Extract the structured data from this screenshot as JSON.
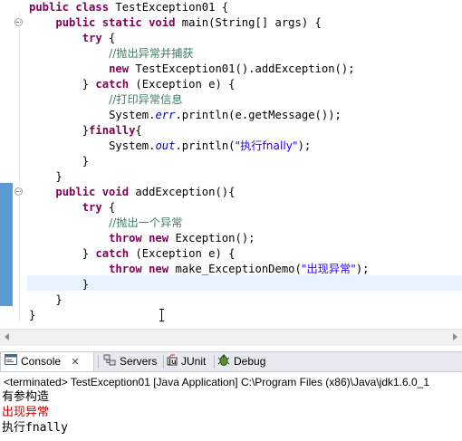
{
  "editor": {
    "lines": {
      "l1": {
        "kw": "public class",
        "rest": " TestException01 {"
      },
      "l2": {
        "kw": "public static void",
        "rest": " main(String[] args) {"
      },
      "l3": {
        "kw": "try",
        "rest": " {"
      },
      "l4": {
        "comment": "//抛出异常并捕获"
      },
      "l5": {
        "kw": "new",
        "rest": " TestException01().addException();"
      },
      "l6": {
        "pre": "} ",
        "kw": "catch",
        "rest": " (Exception e) {"
      },
      "l7": {
        "comment": "//打印异常信息"
      },
      "l8": {
        "pre": "System.",
        "field": "err",
        "rest": ".println(e.getMessage());"
      },
      "l9": {
        "pre": "}",
        "kw": "finally",
        "rest": "{"
      },
      "l10": {
        "pre": "System.",
        "field": "out",
        "mid": ".println(",
        "str": "\"执行fnally\"",
        "rest": ");"
      },
      "l11": {
        "text": "}"
      },
      "l12": {
        "text": "}"
      },
      "l13": {
        "kw": "public void",
        "rest": " addException(){"
      },
      "l14": {
        "kw": "try",
        "rest": " {"
      },
      "l15": {
        "comment": "//抛出一个异常"
      },
      "l16": {
        "kw": "throw new",
        "rest": " Exception();"
      },
      "l17": {
        "pre": "} ",
        "kw": "catch",
        "rest": " (Exception e) {"
      },
      "l18": {
        "kw": "throw new",
        "mid": " make_ExceptionDemo(",
        "str": "\"出现异常\"",
        "rest": ");"
      },
      "l19": {
        "text": "}"
      },
      "l20": {
        "text": "}"
      },
      "l21": {
        "text": "}"
      }
    }
  },
  "tabs": {
    "console": "Console",
    "console_close": "✕",
    "servers": "Servers",
    "junit": "JUnit",
    "debug": "Debug"
  },
  "console": {
    "terminated": "<terminated> TestException01 [Java Application] C:\\Program Files (x86)\\Java\\jdk1.6.0_1",
    "output": [
      "有参构造",
      "出现异常",
      "执行fnally"
    ]
  },
  "colors": {
    "keyword": "#7f0055",
    "comment": "#3f7f5f",
    "field": "#0000c0",
    "string": "#2a00ff",
    "stderr": "#cc0000",
    "changebar": "#5b9bd5",
    "current_line": "#e8f2fe"
  },
  "icons": {
    "console_tab": "console-icon",
    "servers_tab": "servers-icon",
    "junit_tab": "junit-icon",
    "debug_tab": "debug-bug-icon",
    "text_cursor": "ibeam-cursor-icon"
  }
}
